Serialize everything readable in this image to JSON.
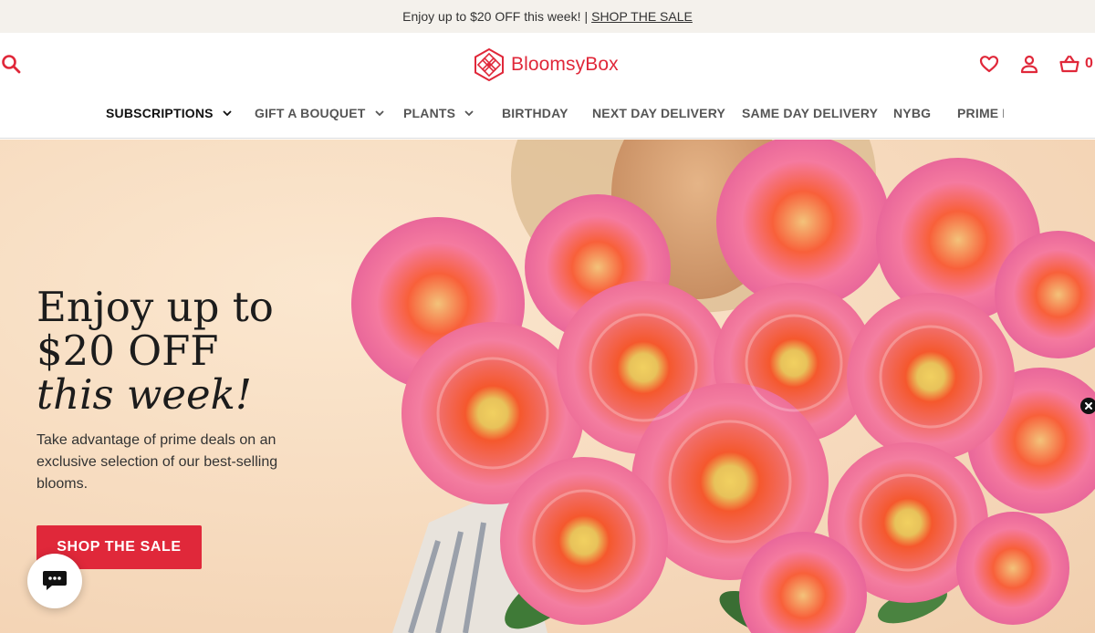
{
  "promo": {
    "text": "Enjoy up to $20 OFF this week!",
    "separator": "|",
    "link": "SHOP THE SALE"
  },
  "header": {
    "logo_text": "BloomsyBox",
    "cart_count": "0",
    "icons": [
      "search-icon",
      "heart-icon",
      "user-icon",
      "basket-icon"
    ]
  },
  "nav": {
    "items": [
      {
        "label": "SUBSCRIPTIONS",
        "has_dropdown": true,
        "active": true
      },
      {
        "label": "GIFT A BOUQUET",
        "has_dropdown": true
      },
      {
        "label": "PLANTS",
        "has_dropdown": true
      },
      {
        "label": "BIRTHDAY"
      },
      {
        "label": "NEXT DAY DELIVERY"
      },
      {
        "label": "SAME DAY DELIVERY"
      },
      {
        "label": "NYBG"
      },
      {
        "label": "PRIME DEALS"
      }
    ]
  },
  "hero": {
    "title_line1": "Enjoy up to",
    "title_line2": "$20 OFF",
    "title_line3": "this week!",
    "subtitle": "Take advantage of prime deals on an exclusive selection of our best-selling blooms.",
    "cta": "SHOP THE SALE"
  },
  "colors": {
    "brand": "#e0283a",
    "promo_bg": "#f4f1ec",
    "hero_bg": "#f7dcc0"
  }
}
